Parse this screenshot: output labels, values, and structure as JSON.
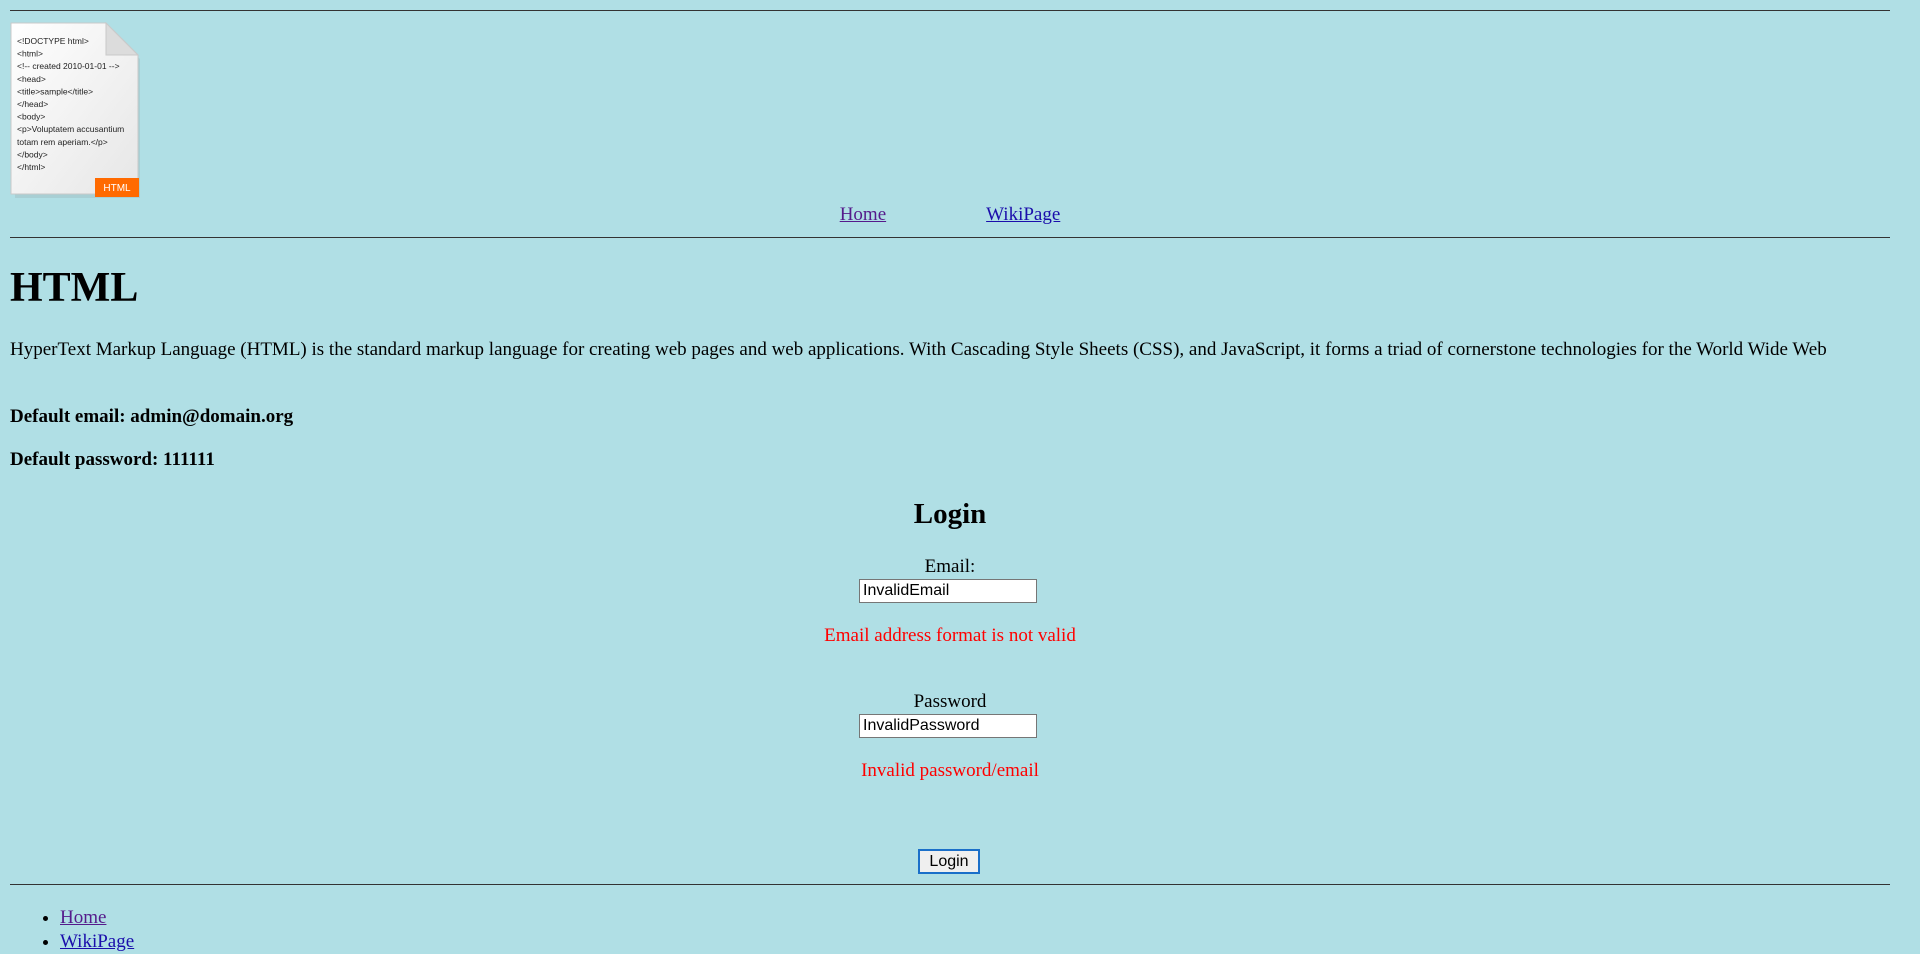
{
  "logo": {
    "icon": "html-file-icon",
    "code_lines": [
      "<!DOCTYPE html>",
      "<html>",
      "<!-- created 2010-01-01 -->",
      " <head>",
      "  <title>sample</title>",
      " </head>",
      " <body>",
      "  <p>Voluptatem accusantium",
      "   totam rem aperiam.</p>",
      " </body>",
      "</html>"
    ],
    "badge": "HTML"
  },
  "nav": {
    "home": "Home",
    "wiki": "WikiPage"
  },
  "main": {
    "title": "HTML",
    "intro": "HyperText Markup Language (HTML) is the standard markup language for creating web pages and web applications. With Cascading Style Sheets (CSS), and JavaScript, it forms a triad of cornerstone technologies for the World Wide Web",
    "default_email": "Default email: admin@domain.org",
    "default_password": "Default password: 111111"
  },
  "login": {
    "heading": "Login",
    "email_label": "Email:",
    "email_value": "InvalidEmail",
    "email_error": "Email address format is not valid",
    "password_label": "Password",
    "password_value": "InvalidPassword",
    "password_error": "Invalid password/email",
    "submit_label": "Login"
  },
  "footer": {
    "items": [
      "Home",
      "WikiPage"
    ]
  },
  "colors": {
    "background": "#b0dfe5",
    "error": "#ff0000",
    "link": "#1a0dab",
    "visited_link": "#551a8b",
    "logo_badge": "#ff6a00"
  }
}
